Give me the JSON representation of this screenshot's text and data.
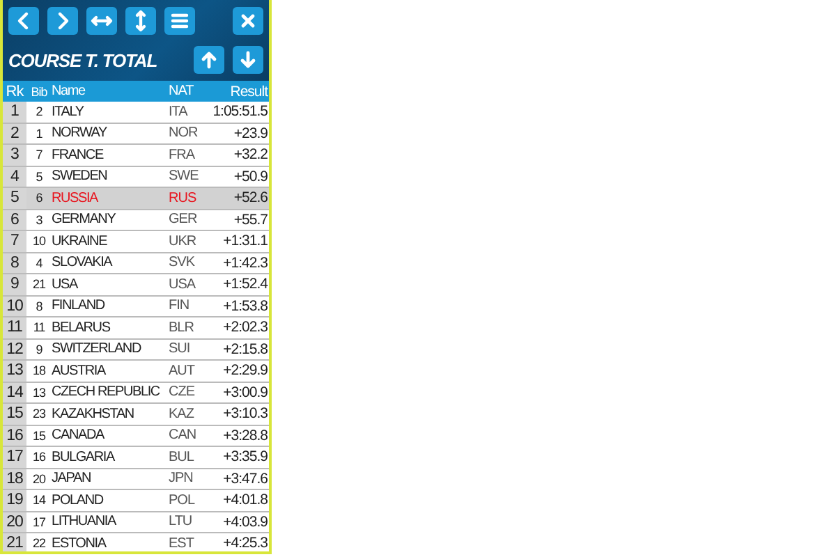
{
  "title": "COURSE T. TOTAL",
  "columns": [
    "Rk",
    "Bib",
    "Name",
    "NAT",
    "Result"
  ],
  "rows": [
    {
      "rank": "1",
      "bib": "2",
      "name": "ITALY",
      "nat": "ITA",
      "result": "1:05:51.5",
      "selected": false
    },
    {
      "rank": "2",
      "bib": "1",
      "name": "NORWAY",
      "nat": "NOR",
      "result": "+23.9",
      "selected": false
    },
    {
      "rank": "3",
      "bib": "7",
      "name": "FRANCE",
      "nat": "FRA",
      "result": "+32.2",
      "selected": false
    },
    {
      "rank": "4",
      "bib": "5",
      "name": "SWEDEN",
      "nat": "SWE",
      "result": "+50.9",
      "selected": false
    },
    {
      "rank": "5",
      "bib": "6",
      "name": "RUSSIA",
      "nat": "RUS",
      "result": "+52.6",
      "selected": true
    },
    {
      "rank": "6",
      "bib": "3",
      "name": "GERMANY",
      "nat": "GER",
      "result": "+55.7",
      "selected": false
    },
    {
      "rank": "7",
      "bib": "10",
      "name": "UKRAINE",
      "nat": "UKR",
      "result": "+1:31.1",
      "selected": false
    },
    {
      "rank": "8",
      "bib": "4",
      "name": "SLOVAKIA",
      "nat": "SVK",
      "result": "+1:42.3",
      "selected": false
    },
    {
      "rank": "9",
      "bib": "21",
      "name": "USA",
      "nat": "USA",
      "result": "+1:52.4",
      "selected": false
    },
    {
      "rank": "10",
      "bib": "8",
      "name": "FINLAND",
      "nat": "FIN",
      "result": "+1:53.8",
      "selected": false
    },
    {
      "rank": "11",
      "bib": "11",
      "name": "BELARUS",
      "nat": "BLR",
      "result": "+2:02.3",
      "selected": false
    },
    {
      "rank": "12",
      "bib": "9",
      "name": "SWITZERLAND",
      "nat": "SUI",
      "result": "+2:15.8",
      "selected": false
    },
    {
      "rank": "13",
      "bib": "18",
      "name": "AUSTRIA",
      "nat": "AUT",
      "result": "+2:29.9",
      "selected": false
    },
    {
      "rank": "14",
      "bib": "13",
      "name": "CZECH REPUBLIC",
      "nat": "CZE",
      "result": "+3:00.9",
      "selected": false
    },
    {
      "rank": "15",
      "bib": "23",
      "name": "KAZAKHSTAN",
      "nat": "KAZ",
      "result": "+3:10.3",
      "selected": false
    },
    {
      "rank": "16",
      "bib": "15",
      "name": "CANADA",
      "nat": "CAN",
      "result": "+3:28.8",
      "selected": false
    },
    {
      "rank": "17",
      "bib": "16",
      "name": "BULGARIA",
      "nat": "BUL",
      "result": "+3:35.9",
      "selected": false
    },
    {
      "rank": "18",
      "bib": "20",
      "name": "JAPAN",
      "nat": "JPN",
      "result": "+3:47.6",
      "selected": false
    },
    {
      "rank": "19",
      "bib": "14",
      "name": "POLAND",
      "nat": "POL",
      "result": "+4:01.8",
      "selected": false
    },
    {
      "rank": "20",
      "bib": "17",
      "name": "LITHUANIA",
      "nat": "LTU",
      "result": "+4:03.9",
      "selected": false
    },
    {
      "rank": "21",
      "bib": "22",
      "name": "ESTONIA",
      "nat": "EST",
      "result": "+4:25.3",
      "selected": false
    }
  ]
}
